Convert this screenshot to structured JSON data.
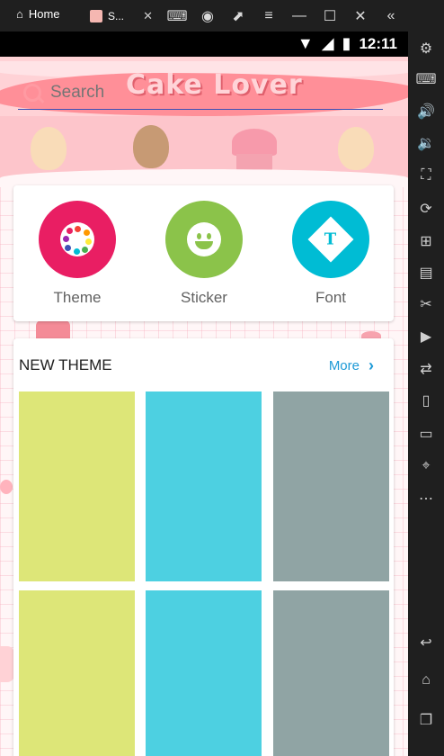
{
  "titlebar": {
    "home_label": "Home",
    "tab_label": "S...",
    "tab_close": "✕",
    "icons": [
      "gamepad-icon",
      "account-icon",
      "external-icon",
      "menu-icon",
      "minimize-icon",
      "restore-icon",
      "close-icon",
      "collapse-icon"
    ],
    "icon_glyphs": [
      "⌨",
      "◉",
      "⬈",
      "≡",
      "—",
      "☐",
      "✕",
      "«"
    ]
  },
  "statusbar": {
    "clock": "12:11"
  },
  "search": {
    "placeholder": "Search"
  },
  "header": {
    "logo_text": "Cake Lover"
  },
  "categories": [
    {
      "label": "Theme",
      "color": "#e91e63"
    },
    {
      "label": "Sticker",
      "color": "#8bc34a"
    },
    {
      "label": "Font",
      "color": "#00bcd4"
    }
  ],
  "font_glyph": "T",
  "new_theme": {
    "title": "NEW THEME",
    "more_label": "More",
    "chevron": "›",
    "tiles": [
      {
        "color": "#dde678"
      },
      {
        "color": "#4dd0e1"
      },
      {
        "color": "#90a4a4"
      },
      {
        "color": "#dde678"
      },
      {
        "color": "#4dd0e1"
      },
      {
        "color": "#90a4a4"
      }
    ]
  },
  "sidebar": {
    "buttons": [
      {
        "name": "settings-icon",
        "glyph": "⚙"
      },
      {
        "name": "keyboard-icon",
        "glyph": "⌨"
      },
      {
        "name": "volume-up-icon",
        "glyph": "🔊"
      },
      {
        "name": "volume-down-icon",
        "glyph": "🔉"
      },
      {
        "name": "screenshot-icon",
        "glyph": "⛶"
      },
      {
        "name": "rotate-icon",
        "glyph": "⟳"
      },
      {
        "name": "add-window-icon",
        "glyph": "⊞"
      },
      {
        "name": "apk-icon",
        "glyph": "▤"
      },
      {
        "name": "cut-icon",
        "glyph": "✂"
      },
      {
        "name": "video-icon",
        "glyph": "▶"
      },
      {
        "name": "sync-icon",
        "glyph": "⇄"
      },
      {
        "name": "shake-icon",
        "glyph": "▯"
      },
      {
        "name": "folder-icon",
        "glyph": "▭"
      },
      {
        "name": "location-icon",
        "glyph": "⌖"
      },
      {
        "name": "more-icon",
        "glyph": "⋯"
      },
      {
        "name": "back-icon",
        "glyph": "↩"
      },
      {
        "name": "home-icon",
        "glyph": "⌂"
      },
      {
        "name": "recents-icon",
        "glyph": "❐"
      }
    ]
  }
}
